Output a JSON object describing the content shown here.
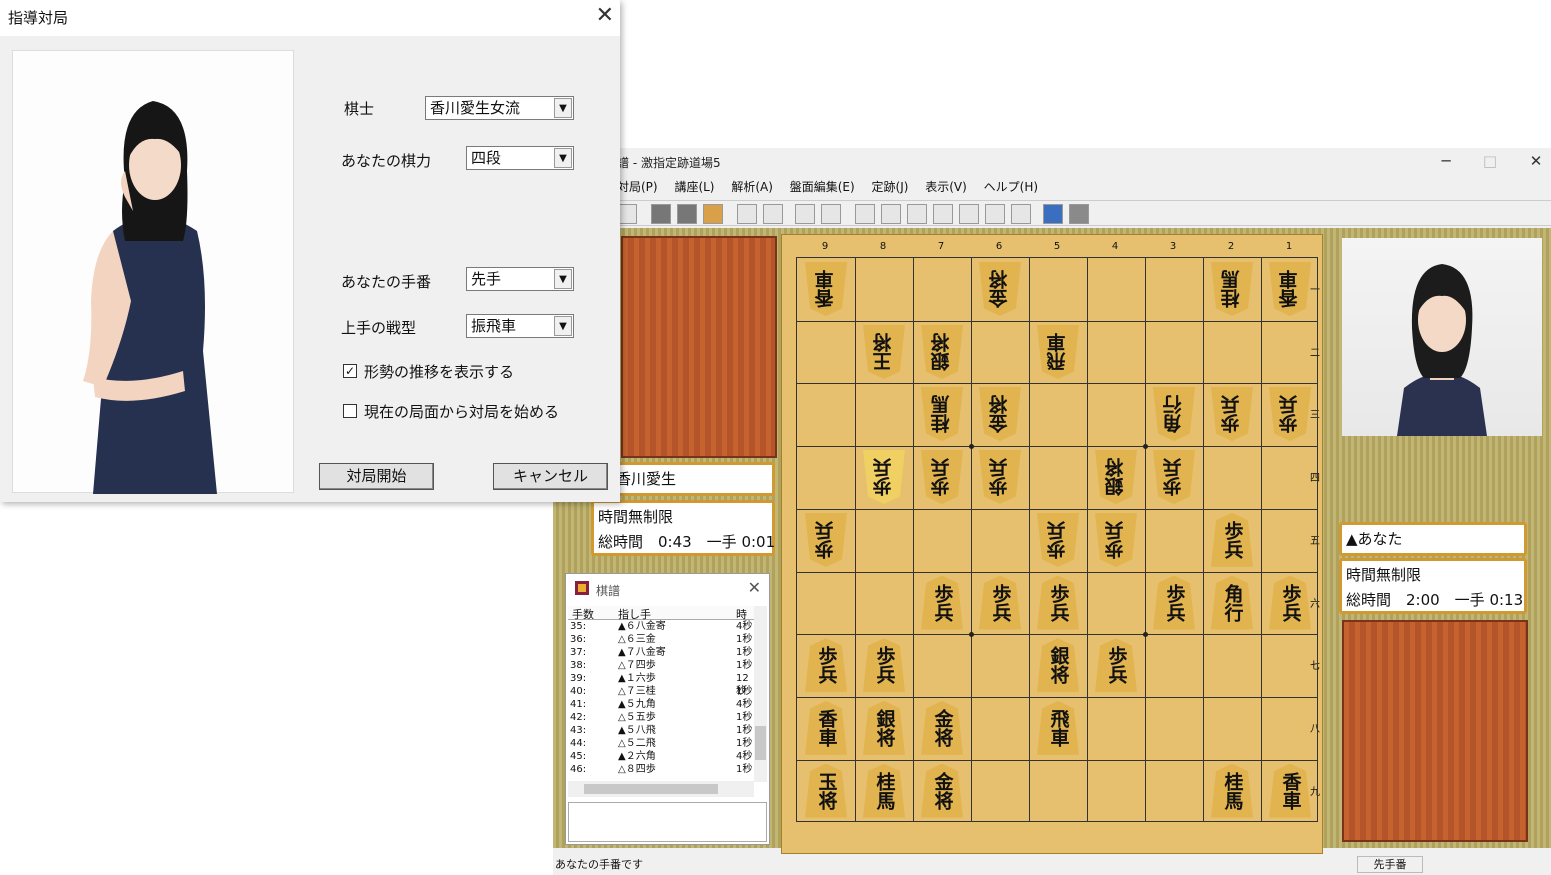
{
  "dialog": {
    "title": "指導対局",
    "close_glyph": "✕",
    "kishi_label": "棋士",
    "kishi_value": "香川愛生女流",
    "strength_label": "あなたの棋力",
    "strength_value": "四段",
    "turn_label": "あなたの手番",
    "turn_value": "先手",
    "tactic_label": "上手の戦型",
    "tactic_value": "振飛車",
    "check1_label": "形勢の推移を表示する",
    "check1_checked": true,
    "check2_label": "現在の局面から対局を始める",
    "check2_checked": false,
    "start_button": "対局開始",
    "cancel_button": "キャンセル",
    "dropdown_arrow": "▼",
    "check_mark": "✓"
  },
  "main": {
    "title": "譜 - 激指定跡道場5",
    "win_min": "─",
    "win_max": "□",
    "win_close": "✕",
    "menu": [
      "対局(P)",
      "講座(L)",
      "解析(A)",
      "盤面編集(E)",
      "定跡(J)",
      "表示(V)",
      "ヘルプ(H)"
    ],
    "file_labels": [
      "9",
      "8",
      "7",
      "6",
      "5",
      "4",
      "3",
      "2",
      "1"
    ],
    "rank_labels": [
      "一",
      "二",
      "三",
      "四",
      "五",
      "六",
      "七",
      "八",
      "九"
    ],
    "pieces": [
      {
        "f": 9,
        "r": 1,
        "c": "香車",
        "g": true
      },
      {
        "f": 6,
        "r": 1,
        "c": "金将",
        "g": true
      },
      {
        "f": 2,
        "r": 1,
        "c": "桂馬",
        "g": true
      },
      {
        "f": 1,
        "r": 1,
        "c": "香車",
        "g": true
      },
      {
        "f": 8,
        "r": 2,
        "c": "王将",
        "g": true
      },
      {
        "f": 7,
        "r": 2,
        "c": "銀将",
        "g": true
      },
      {
        "f": 5,
        "r": 2,
        "c": "飛車",
        "g": true
      },
      {
        "f": 7,
        "r": 3,
        "c": "桂馬",
        "g": true
      },
      {
        "f": 6,
        "r": 3,
        "c": "金将",
        "g": true
      },
      {
        "f": 3,
        "r": 3,
        "c": "角行",
        "g": true
      },
      {
        "f": 2,
        "r": 3,
        "c": "歩兵",
        "g": true
      },
      {
        "f": 1,
        "r": 3,
        "c": "歩兵",
        "g": true
      },
      {
        "f": 8,
        "r": 4,
        "c": "歩兵",
        "g": true,
        "last": true
      },
      {
        "f": 7,
        "r": 4,
        "c": "歩兵",
        "g": true
      },
      {
        "f": 6,
        "r": 4,
        "c": "歩兵",
        "g": true
      },
      {
        "f": 4,
        "r": 4,
        "c": "銀将",
        "g": true
      },
      {
        "f": 3,
        "r": 4,
        "c": "歩兵",
        "g": true
      },
      {
        "f": 9,
        "r": 5,
        "c": "歩兵",
        "g": true
      },
      {
        "f": 5,
        "r": 5,
        "c": "歩兵",
        "g": true
      },
      {
        "f": 4,
        "r": 5,
        "c": "歩兵",
        "g": true
      },
      {
        "f": 2,
        "r": 5,
        "c": "歩兵",
        "g": false
      },
      {
        "f": 7,
        "r": 6,
        "c": "歩兵",
        "g": false
      },
      {
        "f": 6,
        "r": 6,
        "c": "歩兵",
        "g": false
      },
      {
        "f": 5,
        "r": 6,
        "c": "歩兵",
        "g": false
      },
      {
        "f": 3,
        "r": 6,
        "c": "歩兵",
        "g": false
      },
      {
        "f": 2,
        "r": 6,
        "c": "角行",
        "g": false
      },
      {
        "f": 1,
        "r": 6,
        "c": "歩兵",
        "g": false
      },
      {
        "f": 9,
        "r": 7,
        "c": "歩兵",
        "g": false
      },
      {
        "f": 8,
        "r": 7,
        "c": "歩兵",
        "g": false
      },
      {
        "f": 5,
        "r": 7,
        "c": "銀将",
        "g": false
      },
      {
        "f": 4,
        "r": 7,
        "c": "歩兵",
        "g": false
      },
      {
        "f": 9,
        "r": 8,
        "c": "香車",
        "g": false
      },
      {
        "f": 8,
        "r": 8,
        "c": "銀将",
        "g": false
      },
      {
        "f": 7,
        "r": 8,
        "c": "金将",
        "g": false
      },
      {
        "f": 5,
        "r": 8,
        "c": "飛車",
        "g": false
      },
      {
        "f": 9,
        "r": 9,
        "c": "玉将",
        "g": false
      },
      {
        "f": 8,
        "r": 9,
        "c": "桂馬",
        "g": false
      },
      {
        "f": 7,
        "r": 9,
        "c": "金将",
        "g": false
      },
      {
        "f": 2,
        "r": 9,
        "c": "桂馬",
        "g": false
      },
      {
        "f": 1,
        "r": 9,
        "c": "香車",
        "g": false
      }
    ],
    "cpu_name": "香川愛生",
    "cpu_time_rule": "時間無制限",
    "cpu_time_detail": "総時間　0:43　一手 0:01",
    "you_name": "▲あなた",
    "you_time_rule": "時間無制限",
    "you_time_detail": "総時間　2:00　一手 0:13",
    "kifu_title": "棋譜",
    "kifu_close": "✕",
    "kifu_headers": [
      "手数",
      "指し手",
      "時"
    ],
    "kifu_rows": [
      [
        "35:",
        "▲６八金寄",
        "4秒"
      ],
      [
        "36:",
        "△６三金",
        "1秒"
      ],
      [
        "37:",
        "▲７八金寄",
        "1秒"
      ],
      [
        "38:",
        "△７四歩",
        "1秒"
      ],
      [
        "39:",
        "▲１六歩",
        "12秒"
      ],
      [
        "40:",
        "△７三桂",
        "1秒"
      ],
      [
        "41:",
        "▲５九角",
        "4秒"
      ],
      [
        "42:",
        "△５五歩",
        "1秒"
      ],
      [
        "43:",
        "▲５八飛",
        "1秒"
      ],
      [
        "44:",
        "△５二飛",
        "1秒"
      ],
      [
        "45:",
        "▲２六角",
        "4秒"
      ],
      [
        "46:",
        "△８四歩",
        "1秒"
      ]
    ],
    "status_text": "あなたの手番です",
    "status_turn": "先手番"
  }
}
